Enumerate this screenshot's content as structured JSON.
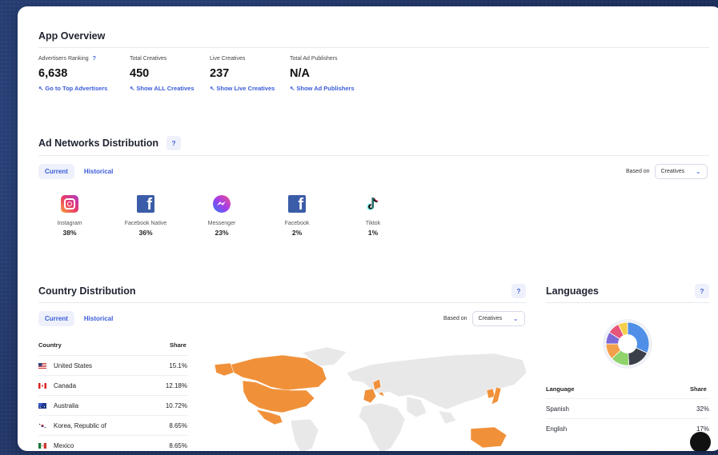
{
  "app_overview": {
    "title": "App Overview",
    "stats": [
      {
        "label": "Advertisers Ranking",
        "value": "6,638",
        "link": "Go to Top Advertisers",
        "help": "?"
      },
      {
        "label": "Total Creatives",
        "value": "450",
        "link": "Show ALL Creatives"
      },
      {
        "label": "Live Creatives",
        "value": "237",
        "link": "Show Live Creatives"
      },
      {
        "label": "Total Ad Publishers",
        "value": "N/A",
        "link": "Show Ad Publishers"
      }
    ]
  },
  "ad_networks": {
    "title": "Ad Networks Distribution",
    "help": "?",
    "tabs": [
      "Current",
      "Historical"
    ],
    "based_on_label": "Based on",
    "based_on_value": "Creatives",
    "networks": [
      {
        "name": "Instagram",
        "share": "38%",
        "icon": "instagram-icon"
      },
      {
        "name": "Facebook Native",
        "share": "36%",
        "icon": "facebook-icon"
      },
      {
        "name": "Messenger",
        "share": "23%",
        "icon": "messenger-icon"
      },
      {
        "name": "Facebook",
        "share": "2%",
        "icon": "facebook-icon"
      },
      {
        "name": "Tiktok",
        "share": "1%",
        "icon": "tiktok-icon"
      }
    ]
  },
  "country": {
    "title": "Country Distribution",
    "help": "?",
    "tabs": [
      "Current",
      "Historical"
    ],
    "based_on_label": "Based on",
    "based_on_value": "Creatives",
    "col_country": "Country",
    "col_share": "Share",
    "rows": [
      {
        "name": "United States",
        "share": "15.1%"
      },
      {
        "name": "Canada",
        "share": "12.18%"
      },
      {
        "name": "Australia",
        "share": "10.72%"
      },
      {
        "name": "Korea, Republic of",
        "share": "8.65%"
      },
      {
        "name": "Mexico",
        "share": "8.65%"
      }
    ]
  },
  "languages": {
    "title": "Languages",
    "help": "?",
    "col_language": "Language",
    "col_share": "Share",
    "rows": [
      {
        "name": "Spanish",
        "share": "32%"
      },
      {
        "name": "English",
        "share": "17%"
      }
    ]
  },
  "colors": {
    "accent": "#3a5bd9",
    "map_highlight": "#f0913a",
    "map_base": "#e6e6e6"
  }
}
